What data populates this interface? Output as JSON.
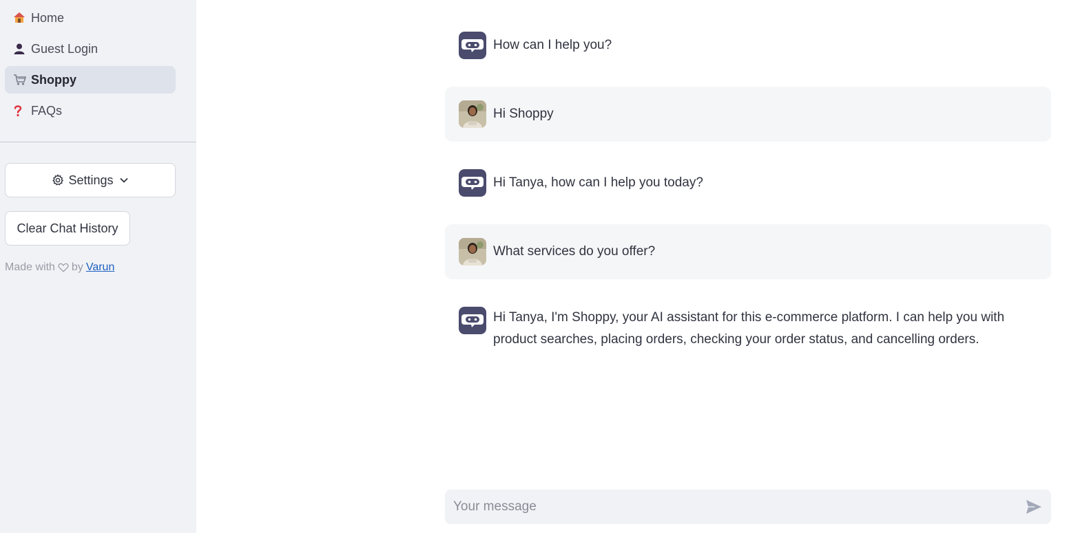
{
  "sidebar": {
    "nav": [
      {
        "label": "Home",
        "icon": "house-icon"
      },
      {
        "label": "Guest Login",
        "icon": "user-icon"
      },
      {
        "label": "Shoppy",
        "icon": "cart-icon",
        "active": true
      },
      {
        "label": "FAQs",
        "icon": "question-icon"
      }
    ],
    "settings_label": "Settings",
    "clear_label": "Clear Chat History",
    "made_with_prefix": "Made with",
    "made_with_by": "by",
    "author": "Varun"
  },
  "chat": {
    "messages": [
      {
        "role": "assistant",
        "text": "How can I help you?"
      },
      {
        "role": "user",
        "text": "Hi Shoppy"
      },
      {
        "role": "assistant",
        "text": "Hi Tanya, how can I help you today?"
      },
      {
        "role": "user",
        "text": "What services do you offer?"
      },
      {
        "role": "assistant",
        "text": "Hi Tanya, I'm Shoppy, your AI assistant for this e-commerce platform. I can help you with product searches, placing orders, checking your order status, and cancelling orders."
      }
    ],
    "input_placeholder": "Your message"
  },
  "colors": {
    "sidebar_bg": "#f0f2f6",
    "active_nav_bg": "#dde2eb",
    "bot_avatar": "#4a4b6d",
    "user_bubble": "#f5f6f8",
    "link": "#1f5fbf"
  }
}
